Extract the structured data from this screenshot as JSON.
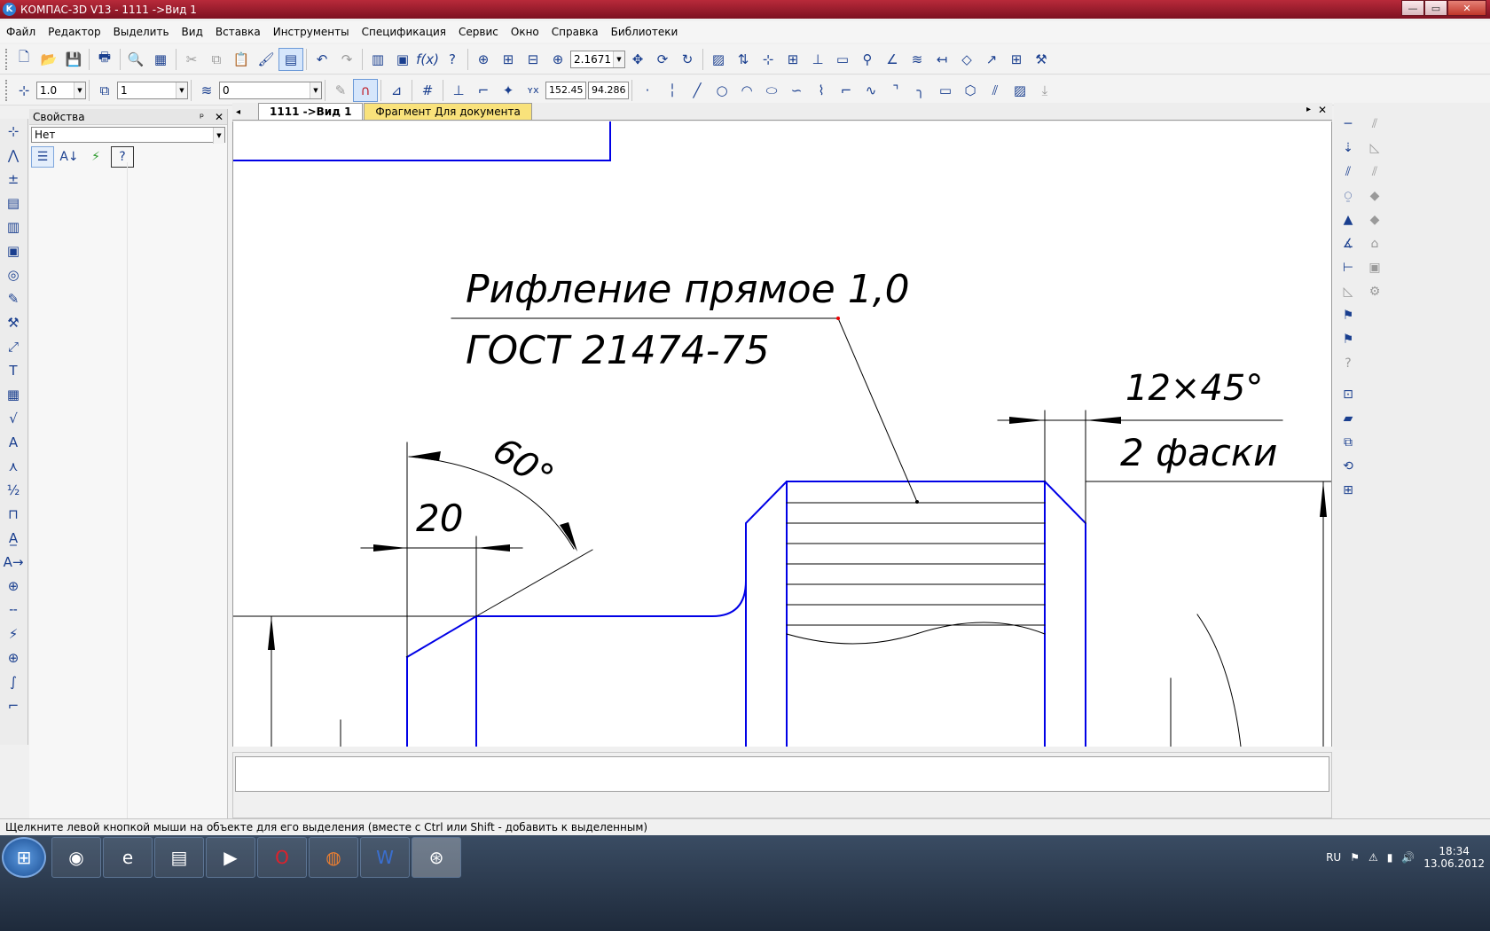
{
  "window": {
    "title": "КОМПАС-3D V13 - 1111 ->Вид 1",
    "app_icon": "kompas-icon",
    "buttons": {
      "minimize": "—",
      "maximize": "▭",
      "close": "✕"
    }
  },
  "menu": [
    "Файл",
    "Редактор",
    "Выделить",
    "Вид",
    "Вставка",
    "Инструменты",
    "Спецификация",
    "Сервис",
    "Окно",
    "Справка",
    "Библиотеки"
  ],
  "toolbar1": {
    "zoom_value": "2.1671"
  },
  "toolbar2": {
    "scale_value": "1.0",
    "layer_value": "1",
    "style_value": "0",
    "coord_x": "152.45",
    "coord_y": "94.286"
  },
  "properties": {
    "title": "Свойства",
    "pin": "ᵖ",
    "close": "✕",
    "selector_value": "Нет"
  },
  "tabs": [
    {
      "label": "1111 ->Вид 1"
    },
    {
      "label": "Фрагмент Для документа"
    }
  ],
  "tab_controls": {
    "left": "◂",
    "right": "▸",
    "close": "✕"
  },
  "drawing": {
    "note_line1": "Рифление прямое 1,0",
    "note_line2": "ГОСТ 21474-75",
    "dim_chamfer": "12×45°",
    "dim_chamfer_note": "2 фаски",
    "dim_angle": "60°",
    "dim_length": "20",
    "line_color": "#0000e6",
    "dim_color": "#000000"
  },
  "status": {
    "text": "Щелкните левой кнопкой мыши на объекте для его выделения (вместе с Ctrl или Shift - добавить к выделенным)"
  },
  "taskbar": {
    "start_icon": "windows-start-icon",
    "apps": [
      "chrome-icon",
      "ie-icon",
      "explorer-icon",
      "media-player-icon",
      "opera-icon",
      "firefox-icon",
      "word-icon",
      "kompas-icon"
    ],
    "lang": "RU",
    "time": "18:34",
    "date": "13.06.2012"
  }
}
